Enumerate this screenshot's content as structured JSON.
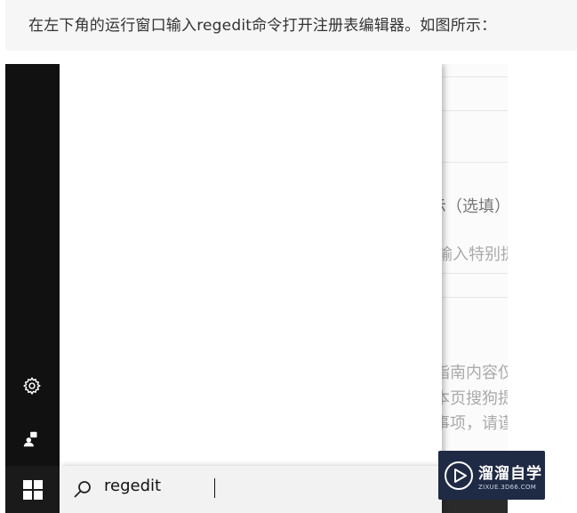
{
  "caption": {
    "text": "在左下角的运行窗口输入regedit命令打开注册表编辑器。如图所示："
  },
  "background_page": {
    "fragments": [
      {
        "text": "示（选填）",
        "style": "normal"
      },
      {
        "text": "输入特别提",
        "style": "light"
      },
      {
        "text": "指南内容仅",
        "style": "light"
      },
      {
        "text": "本页搜狗提",
        "style": "light"
      },
      {
        "text": "事项，请谨",
        "style": "light"
      }
    ]
  },
  "start_menu": {
    "side_icons": [
      "gear-icon",
      "user-icon"
    ],
    "search": {
      "value": "regedit"
    },
    "start_icon": "windows-logo-icon"
  },
  "watermark": {
    "title": "溜溜自学",
    "url": "ZIXUE.3D66.COM"
  },
  "colors": {
    "taskbar": "#111111",
    "search_bar": "#f2f2f2",
    "watermark_bg": "#1f2a44"
  }
}
